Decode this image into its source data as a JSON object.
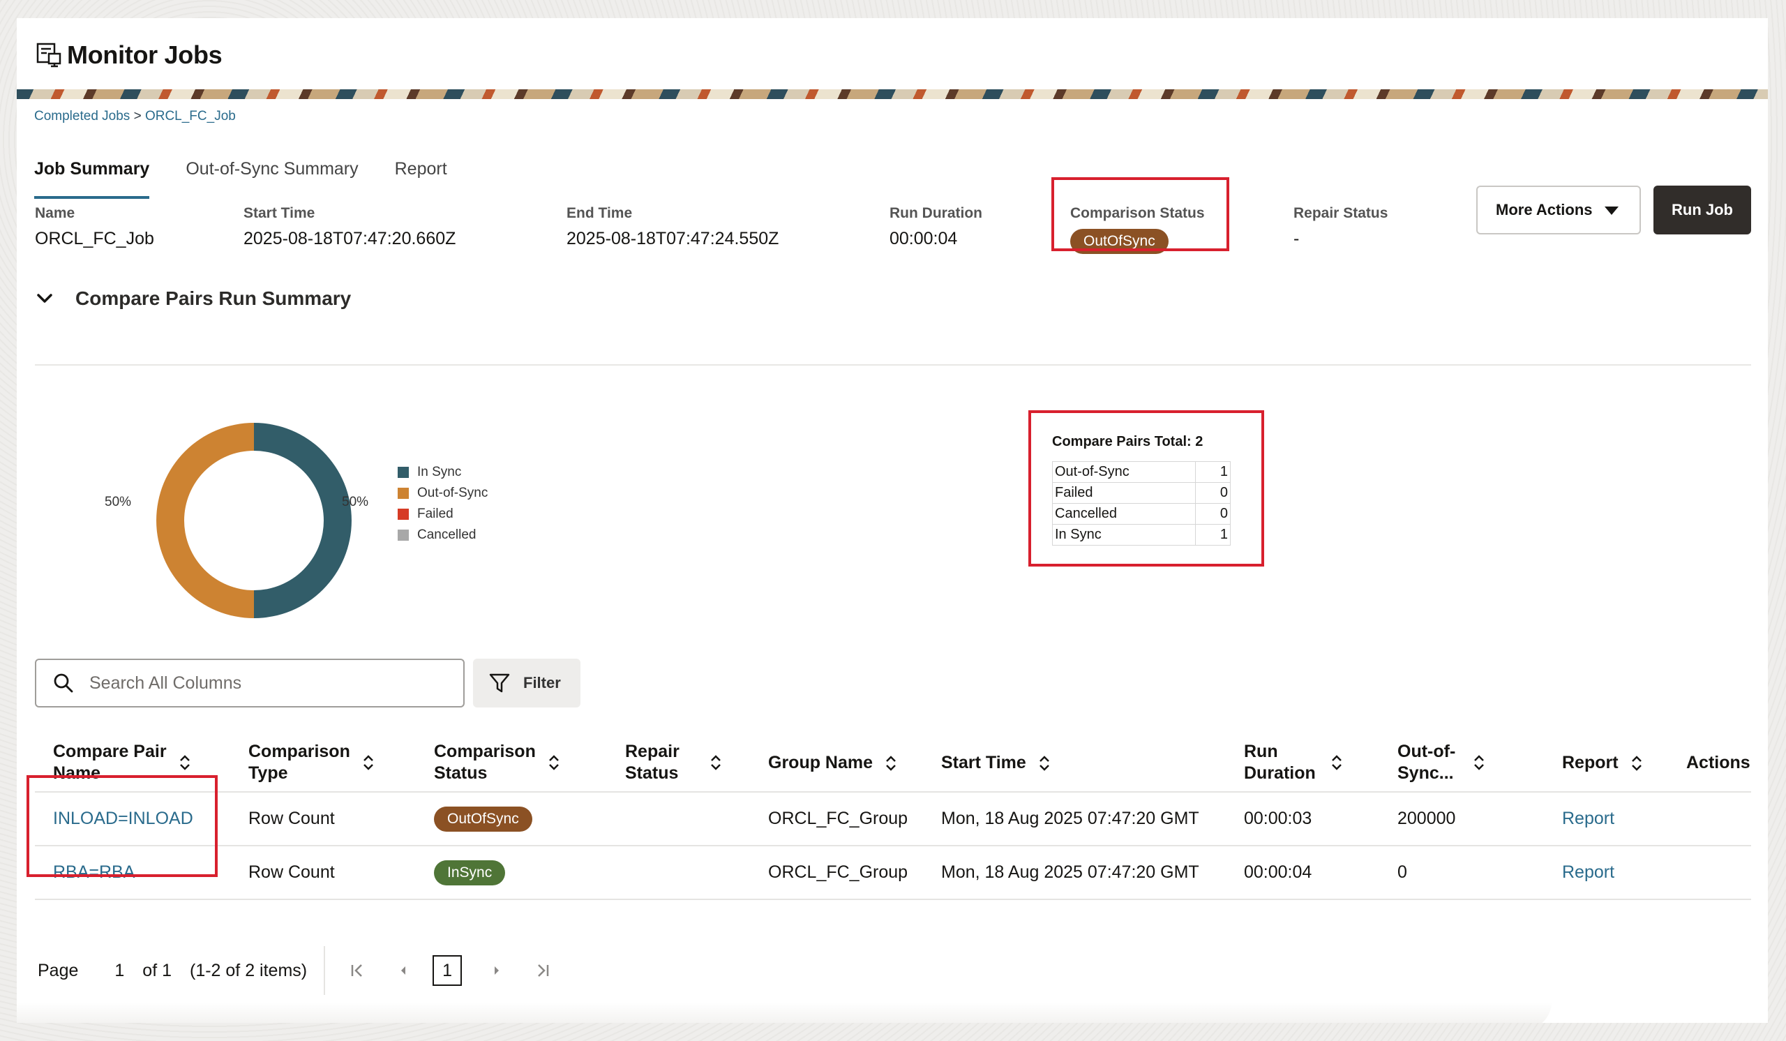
{
  "app": {
    "title": "Monitor Jobs"
  },
  "breadcrumb": {
    "parent": "Completed Jobs",
    "separator": " > ",
    "current": "ORCL_FC_Job"
  },
  "tabs": [
    {
      "label": "Job Summary",
      "active": true
    },
    {
      "label": "Out-of-Sync Summary",
      "active": false
    },
    {
      "label": "Report",
      "active": false
    }
  ],
  "job_info": {
    "name_label": "Name",
    "name": "ORCL_FC_Job",
    "start_label": "Start Time",
    "start": "2025-08-18T07:47:20.660Z",
    "end_label": "End Time",
    "end": "2025-08-18T07:47:24.550Z",
    "duration_label": "Run Duration",
    "duration": "00:00:04",
    "comparison_label": "Comparison Status",
    "comparison": "OutOfSync",
    "repair_label": "Repair Status",
    "repair": "-"
  },
  "actions": {
    "more_actions": "More Actions",
    "run_job": "Run Job"
  },
  "section": {
    "title": "Compare Pairs Run Summary"
  },
  "donut": {
    "left_label": "50%",
    "right_label": "50%",
    "legend": [
      {
        "label": "In Sync",
        "color": "#325d69"
      },
      {
        "label": "Out-of-Sync",
        "color": "#cd8332"
      },
      {
        "label": "Failed",
        "color": "#d63b25"
      },
      {
        "label": "Cancelled",
        "color": "#a8a8a8"
      }
    ]
  },
  "chart_data": {
    "type": "pie",
    "categories": [
      "In Sync",
      "Out-of-Sync",
      "Failed",
      "Cancelled"
    ],
    "values": [
      1,
      1,
      0,
      0
    ],
    "colors": [
      "#325d69",
      "#cd8332",
      "#d63b25",
      "#a8a8a8"
    ],
    "legend_position": "right"
  },
  "summary": {
    "title": "Compare Pairs Total: 2",
    "rows": [
      {
        "label": "Out-of-Sync",
        "value": "1"
      },
      {
        "label": "Failed",
        "value": "0"
      },
      {
        "label": "Cancelled",
        "value": "0"
      },
      {
        "label": "In Sync",
        "value": "1"
      }
    ]
  },
  "search": {
    "placeholder": "Search All Columns",
    "filter_label": "Filter"
  },
  "table": {
    "headers": {
      "name_line1": "Compare Pair",
      "name_line2": "Name",
      "type_line1": "Comparison",
      "type_line2": "Type",
      "status_line1": "Comparison",
      "status_line2": "Status",
      "repair_line1": "Repair",
      "repair_line2": "Status",
      "group": "Group Name",
      "start": "Start Time",
      "duration_line1": "Run",
      "duration_line2": "Duration",
      "oos_line1": "Out-of-",
      "oos_line2": "Sync...",
      "report": "Report",
      "actions": "Actions"
    },
    "rows": [
      {
        "name": "INLOAD=INLOAD",
        "type": "Row Count",
        "status": "OutOfSync",
        "repair": "",
        "group": "ORCL_FC_Group",
        "start": "Mon, 18 Aug 2025 07:47:20 GMT",
        "duration": "00:00:03",
        "oos": "200000",
        "report": "Report"
      },
      {
        "name": "RBA=RBA",
        "type": "Row Count",
        "status": "InSync",
        "repair": "",
        "group": "ORCL_FC_Group",
        "start": "Mon, 18 Aug 2025 07:47:20 GMT",
        "duration": "00:00:04",
        "oos": "0",
        "report": "Report"
      }
    ]
  },
  "pagination": {
    "page_label": "Page",
    "page": "1",
    "of_label": "of 1",
    "items": "(1-2 of 2 items)",
    "current": "1"
  }
}
